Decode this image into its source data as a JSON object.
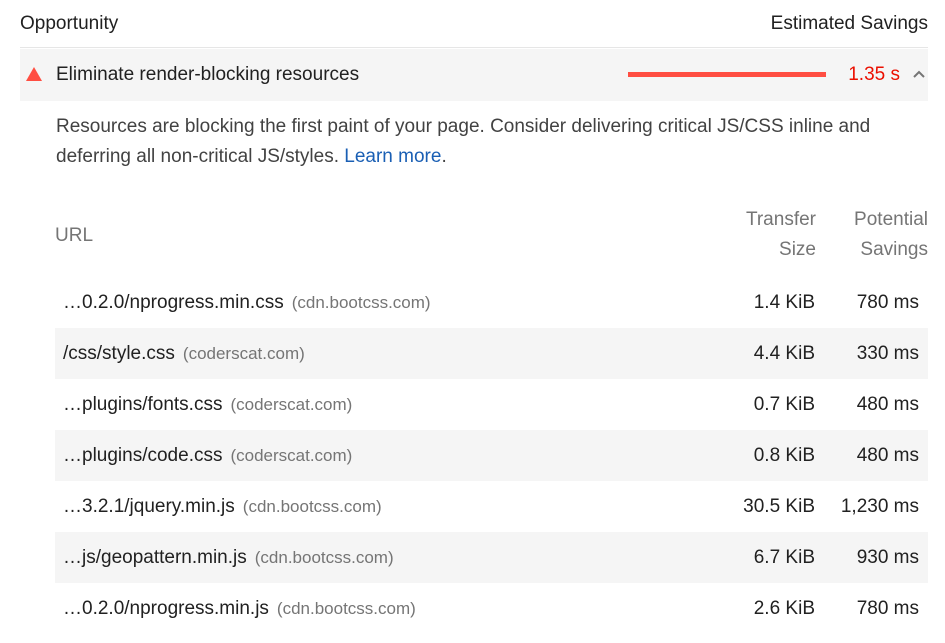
{
  "header": {
    "opportunity_label": "Opportunity",
    "savings_label": "Estimated Savings"
  },
  "audit": {
    "icon": "fail-triangle-icon",
    "title": "Eliminate render-blocking resources",
    "savings_value": "1.35 s",
    "savings_bar_fraction": 1.0,
    "expanded": true,
    "fail_color": "#ff4e42",
    "savings_text_color": "#eb0f00"
  },
  "description": {
    "text": "Resources are blocking the first paint of your page. Consider delivering critical JS/CSS inline and deferring all non-critical JS/styles.",
    "link_text": "Learn more",
    "tail": "."
  },
  "table": {
    "columns": {
      "url": "URL",
      "transfer_line1": "Transfer",
      "transfer_line2": "Size",
      "savings_line1": "Potential",
      "savings_line2": "Savings"
    },
    "rows": [
      {
        "url": "…0.2.0/nprogress.min.css",
        "host": "(cdn.bootcss.com)",
        "size": "1.4 KiB",
        "savings": "780 ms"
      },
      {
        "url": "/css/style.css",
        "host": "(coderscat.com)",
        "size": "4.4 KiB",
        "savings": "330 ms"
      },
      {
        "url": "…plugins/fonts.css",
        "host": "(coderscat.com)",
        "size": "0.7 KiB",
        "savings": "480 ms"
      },
      {
        "url": "…plugins/code.css",
        "host": "(coderscat.com)",
        "size": "0.8 KiB",
        "savings": "480 ms"
      },
      {
        "url": "…3.2.1/jquery.min.js",
        "host": "(cdn.bootcss.com)",
        "size": "30.5 KiB",
        "savings": "1,230 ms"
      },
      {
        "url": "…js/geopattern.min.js",
        "host": "(cdn.bootcss.com)",
        "size": "6.7 KiB",
        "savings": "930 ms"
      },
      {
        "url": "…0.2.0/nprogress.min.js",
        "host": "(cdn.bootcss.com)",
        "size": "2.6 KiB",
        "savings": "780 ms"
      }
    ]
  }
}
